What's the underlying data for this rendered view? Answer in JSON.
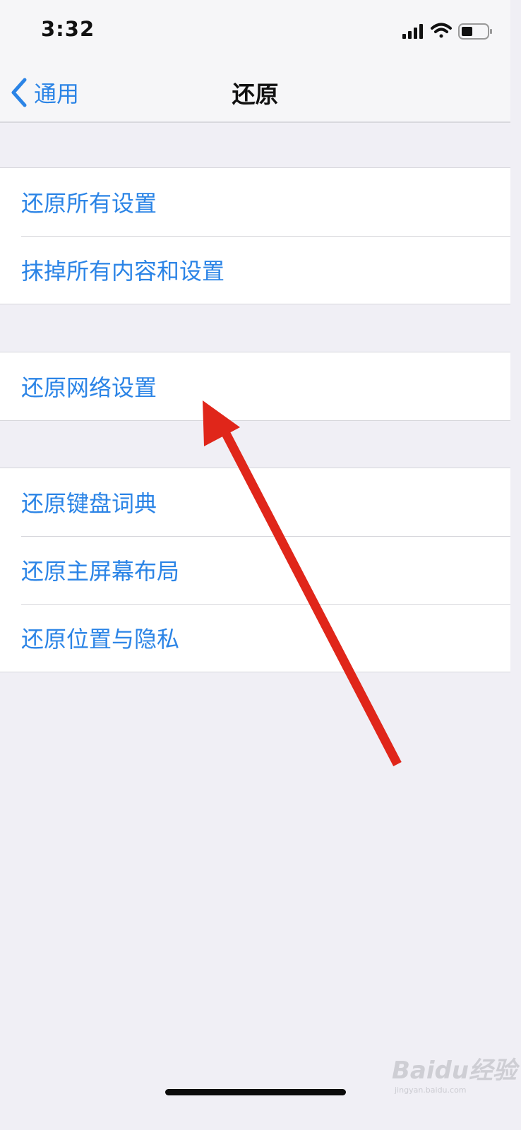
{
  "status_bar": {
    "time": "3:32",
    "icons": [
      "signal-icon",
      "wifi-icon",
      "battery-icon"
    ]
  },
  "nav": {
    "back_label": "通用",
    "title": "还原"
  },
  "groups": [
    {
      "items": [
        {
          "label": "还原所有设置"
        },
        {
          "label": "抹掉所有内容和设置"
        }
      ]
    },
    {
      "items": [
        {
          "label": "还原网络设置"
        }
      ]
    },
    {
      "items": [
        {
          "label": "还原键盘词典"
        },
        {
          "label": "还原主屏幕布局"
        },
        {
          "label": "还原位置与隐私"
        }
      ]
    }
  ],
  "annotation": {
    "arrow_color": "#e0261a",
    "points_to": "还原网络设置"
  },
  "watermark": {
    "logo_text": "Baidu经验",
    "sub_text": "jingyan.baidu.com"
  },
  "colors": {
    "accent": "#2b84e6",
    "background": "#f0eff5",
    "nav_background": "#f6f6f8",
    "cell_background": "#ffffff",
    "separator": "#d6d6db"
  }
}
